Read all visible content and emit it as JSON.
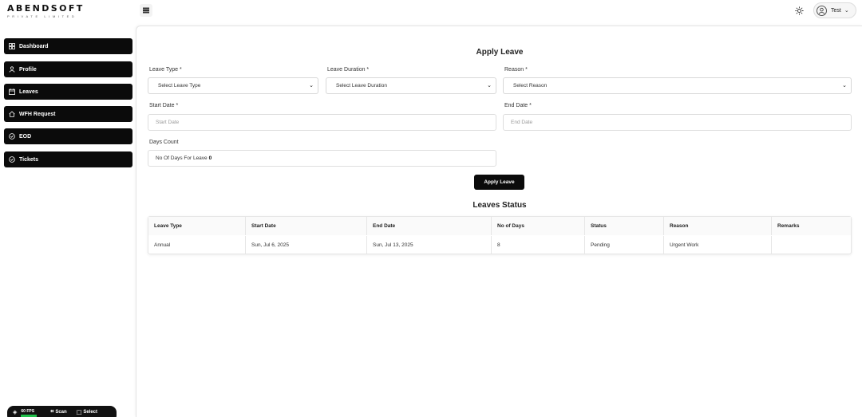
{
  "brand": {
    "name": "ABENDSOFT",
    "tagline": "PRIVATE LIMITED"
  },
  "header": {
    "user_name": "Test",
    "menu_icon": "hamburger-icon",
    "theme_icon": "sun-icon",
    "user_icon": "user-icon"
  },
  "sidebar": {
    "items": [
      {
        "label": "Dashboard",
        "icon": "dashboard-icon"
      },
      {
        "label": "Profile",
        "icon": "user-icon"
      },
      {
        "label": "Leaves",
        "icon": "calendar-icon"
      },
      {
        "label": "WFH Request",
        "icon": "home-icon"
      },
      {
        "label": "EOD",
        "icon": "check-circle-icon"
      },
      {
        "label": "Tickets",
        "icon": "check-circle-icon"
      }
    ]
  },
  "form": {
    "title": "Apply Leave",
    "leave_type": {
      "label": "Leave Type *",
      "value": "Select Leave Type"
    },
    "leave_duration": {
      "label": "Leave Duration *",
      "value": "Select Leave Duration"
    },
    "reason": {
      "label": "Reason *",
      "value": "Select Reason"
    },
    "start_date": {
      "label": "Start Date *",
      "placeholder": "Start Date"
    },
    "end_date": {
      "label": "End Date *",
      "placeholder": "End Date"
    },
    "days_count": {
      "label": "Days Count",
      "text": "No Of Days For Leave",
      "value": "0"
    },
    "submit_label": "Apply Leave"
  },
  "status": {
    "title": "Leaves Status",
    "columns": [
      "Leave Type",
      "Start Date",
      "End Date",
      "No of Days",
      "Status",
      "Reason",
      "Remarks"
    ],
    "rows": [
      [
        "Annual",
        "Sun, Jul 6, 2025",
        "Sun, Jul 13, 2025",
        "8",
        "Pending",
        "Urgent Work",
        ""
      ]
    ]
  },
  "widget": {
    "fps": "60",
    "fps_unit": "FPS",
    "scan_label": "Scan",
    "select_label": "Select"
  }
}
